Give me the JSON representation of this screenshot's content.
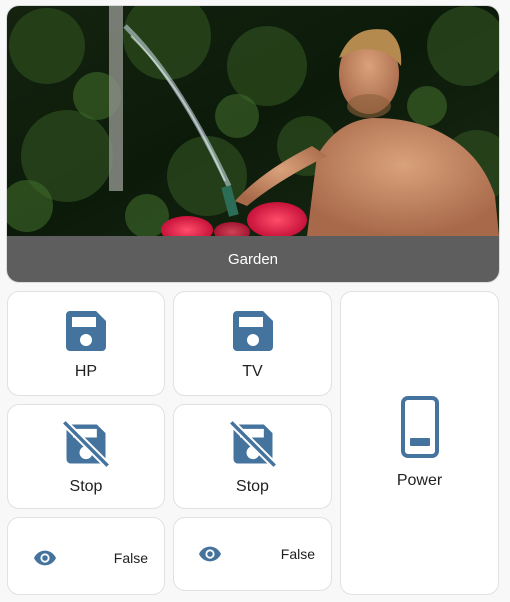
{
  "picture": {
    "caption": "Garden"
  },
  "buttons": [
    {
      "label": "HP",
      "icon": "floppy-disk-icon"
    },
    {
      "label": "TV",
      "icon": "floppy-disk-icon"
    },
    {
      "label": "Stop",
      "icon": "floppy-disk-off-icon"
    },
    {
      "label": "Stop",
      "icon": "floppy-disk-off-icon"
    },
    {
      "label": "Power",
      "icon": "cellphone-icon"
    }
  ],
  "entities": [
    {
      "state": "False",
      "icon": "eye-icon"
    },
    {
      "state": "False",
      "icon": "eye-icon"
    }
  ],
  "colors": {
    "icon": "#44739e",
    "caption_bar": "#5e5e5e",
    "card": "#ffffff",
    "background": "#f8f8f8"
  }
}
